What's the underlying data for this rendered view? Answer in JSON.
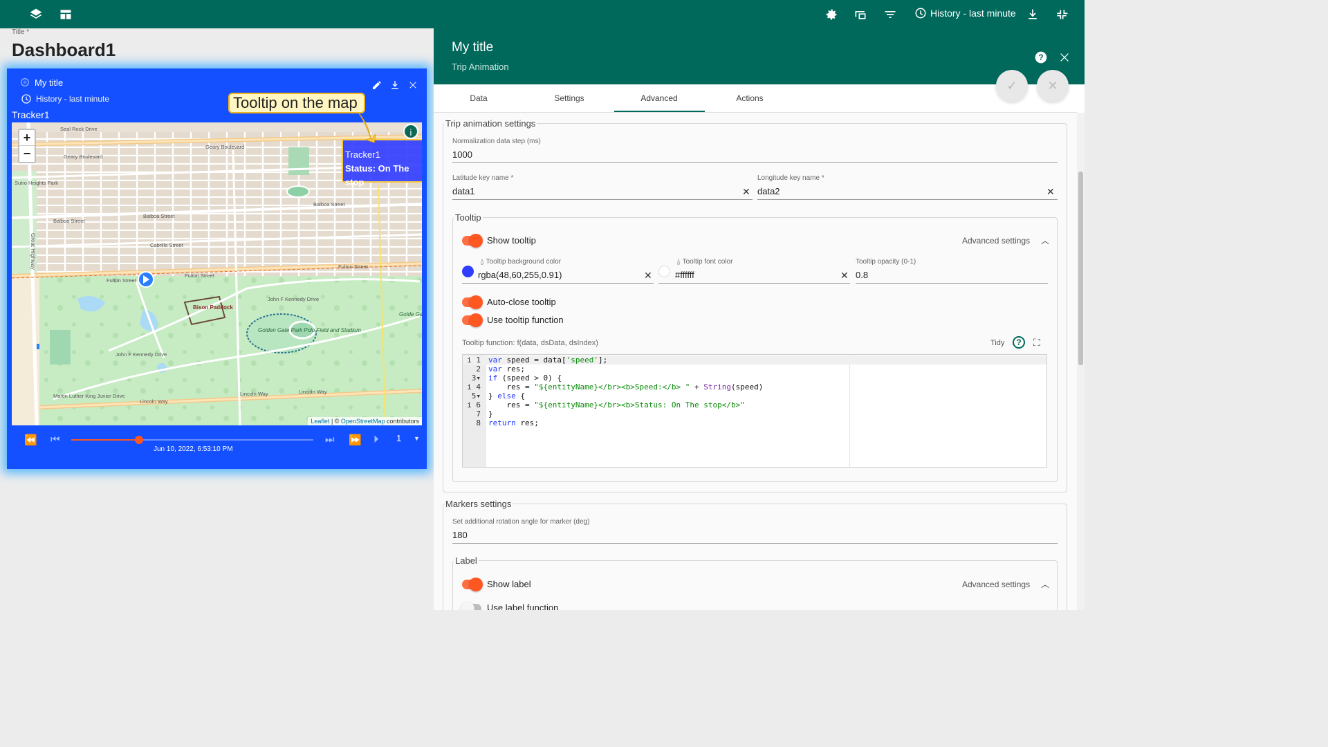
{
  "topbar": {
    "history_label": "History - last minute",
    "icons": [
      "layers-icon",
      "dashboard-layout-icon",
      "settings-icon",
      "devices-icon",
      "filter-icon",
      "clock-icon",
      "download-icon",
      "fullscreen-exit-icon"
    ]
  },
  "dashboard": {
    "title_label": "Title *",
    "title": "Dashboard1"
  },
  "widget": {
    "title": "My title",
    "timewindow": "History - last minute",
    "entity": "Tracker1",
    "callout": "Tooltip on the map",
    "map_tooltip": {
      "name": "Tracker1",
      "status": "Status: On The stop"
    },
    "attribution": {
      "leaflet": "Leaflet",
      "sep": " | © ",
      "osm": "OpenStreetMap",
      "contributors": " contributors"
    },
    "zoom": {
      "in": "+",
      "out": "−"
    },
    "timestamp": "Jun 10, 2022, 6:53:10 PM",
    "speed": "1",
    "progress": 0.28,
    "map_labels": {
      "geary": "Geary Boulevard",
      "geary2": "Geary Boulevard",
      "balboa": "Balboa Street",
      "balboa2": "Balboa Street",
      "balboa3": "Balboa Street",
      "fulton": "Fulton Street",
      "fulton2": "Fulton Street",
      "fulton3": "Fulton Street",
      "lincoln": "Lincoln Way",
      "lincoln2": "Lincoln Way",
      "lincoln3": "Lincoln Way",
      "jfk": "John F Kennedy Drive",
      "jfk2": "John F Kennedy Drive",
      "bison": "Bison Paddock",
      "polo": "Golden Gate Park Polo Field and Stadium",
      "sutro": "Sutro Heights Park",
      "great": "Great Highway",
      "mlk": "Martin Luther King Junior Drive",
      "seal": "Seal Rock Drive",
      "cabrillo": "Cabrillo Street",
      "golden": "Golde Gate Pa"
    }
  },
  "panel": {
    "title": "My title",
    "subtitle": "Trip Animation",
    "tabs": [
      "Data",
      "Settings",
      "Advanced",
      "Actions"
    ],
    "trip": {
      "legend": "Trip animation settings",
      "norm_label": "Normalization data step (ms)",
      "norm_value": "1000",
      "lat_label": "Latitude key name *",
      "lat_value": "data1",
      "lon_label": "Longitude key name *",
      "lon_value": "data2"
    },
    "tooltip": {
      "legend": "Tooltip",
      "show_label": "Show tooltip",
      "advanced": "Advanced settings",
      "bg_label": "Tooltip background color",
      "bg_value": "rgba(48,60,255,0.91)",
      "font_label": "Tooltip font color",
      "font_value": "#ffffff",
      "opacity_label": "Tooltip opacity (0-1)",
      "opacity_value": "0.8",
      "autoclose_label": "Auto-close tooltip",
      "usefn_label": "Use tooltip function",
      "fn_label": "Tooltip function: f(data, dsData, dsIndex)",
      "tidy": "Tidy",
      "code": [
        "var speed = data['speed'];",
        "var res;",
        "if (speed > 0) {",
        "    res = \"${entityName}</br><b>Speed:</b> \" + String(speed)",
        "} else {",
        "    res = \"${entityName}</br><b>Status: On The stop</b>\"",
        "}",
        "return res;"
      ]
    },
    "markers": {
      "legend": "Markers settings",
      "rot_label": "Set additional rotation angle for marker (deg)",
      "rot_value": "180"
    },
    "label": {
      "legend": "Label",
      "show_label": "Show label",
      "advanced": "Advanced settings",
      "fn_label": "Use label function"
    }
  },
  "colors": {
    "topbar": "#00695c",
    "widget_bg": "#1450ff",
    "toggle": "#ff5722",
    "tooltip_bg": "#303cff"
  }
}
